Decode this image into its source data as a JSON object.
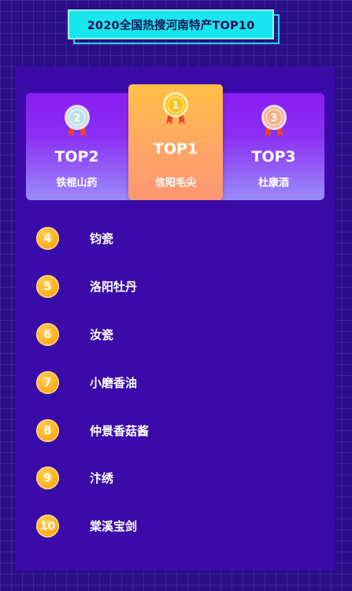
{
  "header": {
    "title": "2020全国热搜河南特产TOP10"
  },
  "podium": {
    "first": {
      "rank": "1",
      "label": "TOP1",
      "name": "信阳毛尖",
      "medal_color": "#ffc21a"
    },
    "second": {
      "rank": "2",
      "label": "TOP2",
      "name": "铁棍山药",
      "medal_color": "#bfe0e8"
    },
    "third": {
      "rank": "3",
      "label": "TOP3",
      "name": "杜康酒",
      "medal_color": "#f7b08a"
    }
  },
  "list": [
    {
      "rank": "4",
      "name": "钧瓷"
    },
    {
      "rank": "5",
      "name": "洛阳牡丹"
    },
    {
      "rank": "6",
      "name": "汝瓷"
    },
    {
      "rank": "7",
      "name": "小磨香油"
    },
    {
      "rank": "8",
      "name": "仲景香菇酱"
    },
    {
      "rank": "9",
      "name": "汴绣"
    },
    {
      "rank": "10",
      "name": "棠溪宝剑"
    }
  ]
}
